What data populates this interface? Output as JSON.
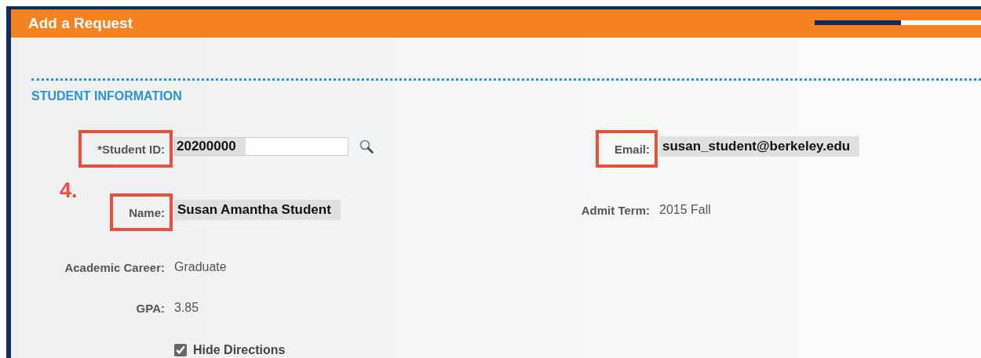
{
  "header": {
    "title": "Add a Request"
  },
  "section": {
    "title": "STUDENT INFORMATION"
  },
  "step_marker": "4.",
  "rows": [
    {
      "fields": [
        {
          "label": "*Student ID:",
          "value": "20200000",
          "kind": "input",
          "highlighted": true
        },
        {
          "label": "Email:",
          "value": "susan_student@berkeley.edu",
          "kind": "shaded",
          "highlighted": true
        }
      ]
    },
    {
      "fields": [
        {
          "label": "Name:",
          "value": "Susan Amantha Student",
          "kind": "shaded",
          "highlighted": true
        },
        {
          "label": "Admit Term:",
          "value": "2015 Fall",
          "kind": "plain",
          "highlighted": false
        }
      ]
    },
    {
      "fields": [
        {
          "label": "Academic Career:",
          "value": "Graduate",
          "kind": "plain",
          "highlighted": false
        }
      ]
    },
    {
      "fields": [
        {
          "label": "GPA:",
          "value": "3.85",
          "kind": "plain",
          "highlighted": false
        }
      ]
    }
  ],
  "hide_directions": {
    "label": "Hide Directions",
    "checked": true
  }
}
